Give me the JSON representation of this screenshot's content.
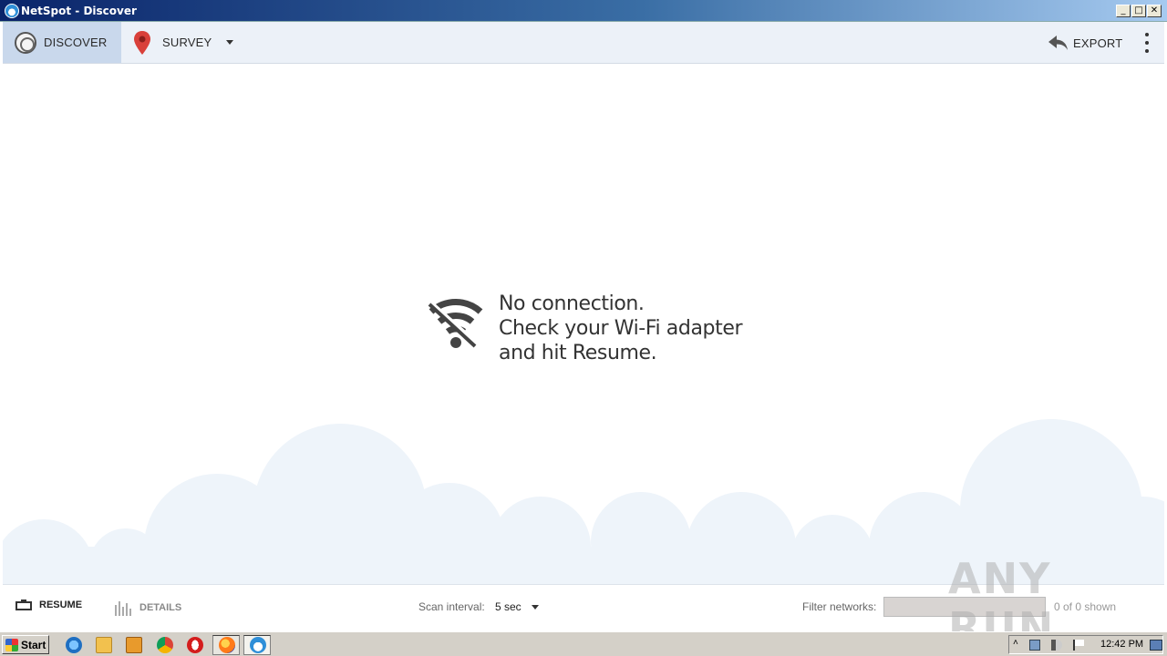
{
  "window": {
    "title": "NetSpot - Discover",
    "minimize": "_",
    "maximize": "□",
    "close": "✕"
  },
  "toolbar": {
    "discover_label": "DISCOVER",
    "survey_label": "SURVEY",
    "export_label": "EXPORT"
  },
  "main": {
    "message_line1": "No connection.",
    "message_line2": "Check your Wi-Fi adapter",
    "message_line3": "and hit Resume."
  },
  "bottombar": {
    "resume_label": "RESUME",
    "details_label": "DETAILS",
    "scan_interval_label": "Scan interval:",
    "scan_interval_value": "5 sec",
    "filter_label": "Filter networks:",
    "filter_value": "",
    "shown_text": "0 of 0 shown"
  },
  "watermark": "ANY RUN",
  "taskbar": {
    "start_label": "Start",
    "clock": "12:42 PM"
  },
  "colors": {
    "toolbar_bg": "#ecf1f8",
    "active_tab_bg": "#c9d8ec",
    "cloud": "#eef4fa",
    "pin": "#d9403a"
  }
}
